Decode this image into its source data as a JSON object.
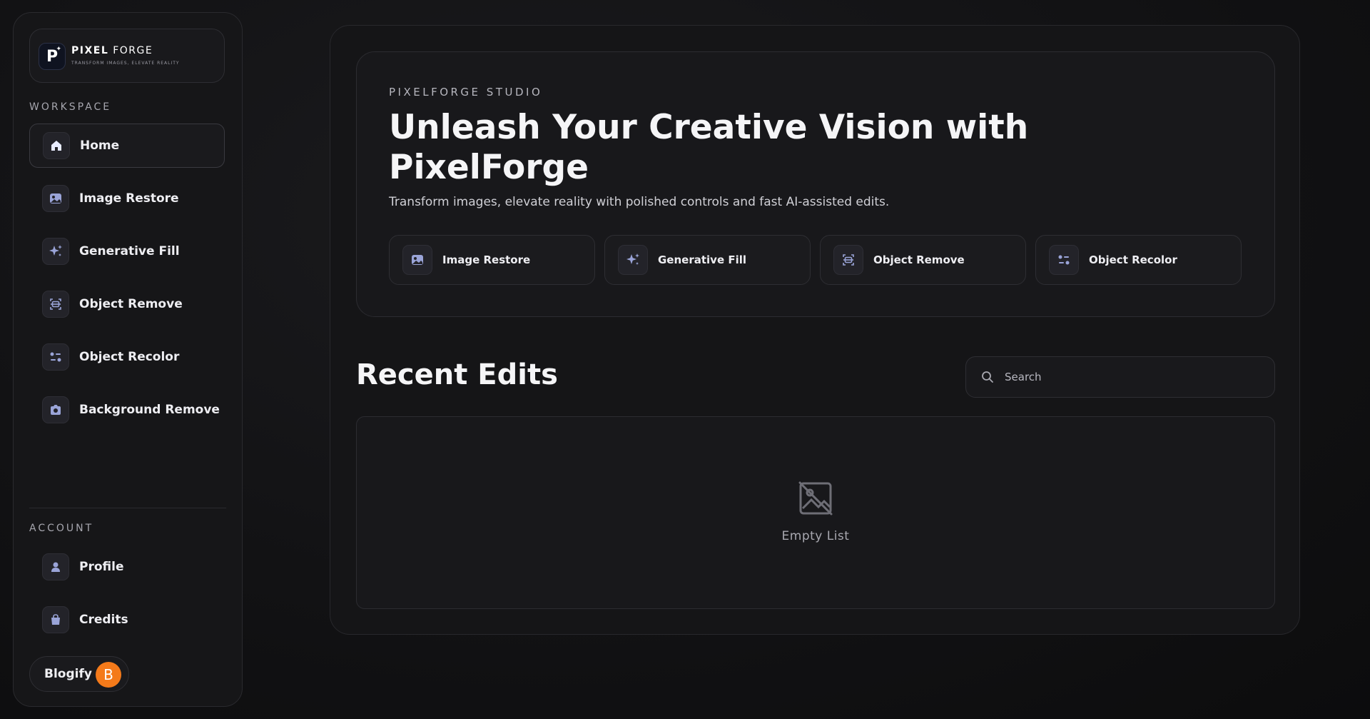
{
  "brand": {
    "name_bold": "PIXEL",
    "name_rest": " FORGE",
    "tagline": "Transform images, elevate reality",
    "logo_letter": "P"
  },
  "sidebar": {
    "workspace_label": "WORKSPACE",
    "workspace_items": [
      {
        "label": "Home",
        "icon": "home-icon",
        "active": true
      },
      {
        "label": "Image Restore",
        "icon": "image-icon"
      },
      {
        "label": "Generative Fill",
        "icon": "sparkles-icon"
      },
      {
        "label": "Object Remove",
        "icon": "scan-icon"
      },
      {
        "label": "Object Recolor",
        "icon": "sliders-icon"
      },
      {
        "label": "Background Remove",
        "icon": "camera-icon"
      }
    ],
    "account_label": "ACCOUNT",
    "account_items": [
      {
        "label": "Profile",
        "icon": "user-icon"
      },
      {
        "label": "Credits",
        "icon": "bag-icon"
      }
    ],
    "user": {
      "name": "Blogify",
      "avatar_letter": "B",
      "avatar_color": "#f47a1a"
    }
  },
  "hero": {
    "kicker": "PIXELFORGE STUDIO",
    "title": "Unleash Your Creative Vision with PixelForge",
    "subtitle": "Transform images, elevate reality with polished controls and fast AI-assisted edits.",
    "quick_actions": [
      {
        "label": "Image Restore",
        "icon": "image-icon"
      },
      {
        "label": "Generative Fill",
        "icon": "sparkles-icon"
      },
      {
        "label": "Object Remove",
        "icon": "scan-icon"
      },
      {
        "label": "Object Recolor",
        "icon": "sliders-icon"
      }
    ]
  },
  "recent": {
    "title": "Recent Edits",
    "search_placeholder": "Search",
    "empty_text": "Empty List",
    "empty_icon": "image-off-icon"
  },
  "colors": {
    "accent_icon": "#9aa4d8",
    "avatar": "#f47a1a"
  }
}
